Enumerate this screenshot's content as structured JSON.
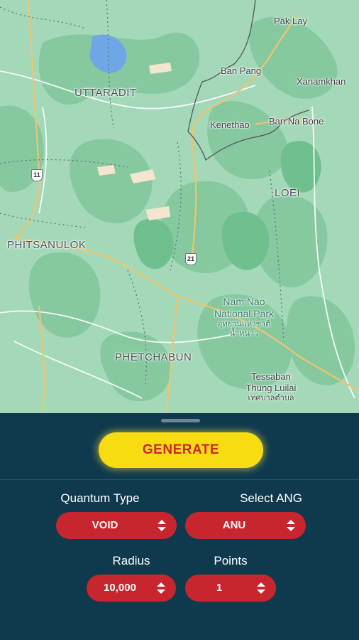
{
  "map": {
    "labels": {
      "pak_lay": "Pak Lay",
      "ban_pang": "Ban Pang",
      "xanamkhan": "Xanamkhan",
      "uttaradit": "UTTARADIT",
      "kenethao": "Kenethao",
      "ban_na_bone": "Ban Na Bone",
      "loei": "LOEI",
      "phitsanulok": "PHITSANULOK",
      "nam_nao_1": "Nam Nao",
      "nam_nao_2": "National Park",
      "nam_nao_thai_1": "อุทยานแห่งชาติ",
      "nam_nao_thai_2": "น้ำหนาว",
      "phetchabun": "PHETCHABUN",
      "tessaban_1": "Tessaban",
      "tessaban_2": "Thung Luilai",
      "tessaban_thai": "เทศบาลตำบล"
    },
    "route_11": "11",
    "route_21": "21"
  },
  "controls": {
    "generate_label": "GENERATE",
    "quantum_type_label": "Quantum Type",
    "quantum_type_value": "VOID",
    "select_ang_label": "Select ANG",
    "select_ang_value": "ANU",
    "radius_label": "Radius",
    "radius_value": "10,000",
    "points_label": "Points",
    "points_value": "1"
  },
  "colors": {
    "map_base": "#9fd8b5",
    "forest": "#7fc79b",
    "sheet_bg": "#0f3a4e",
    "generate_bg": "#f7dc12",
    "generate_text": "#d1232a",
    "select_bg": "#c8262e"
  }
}
